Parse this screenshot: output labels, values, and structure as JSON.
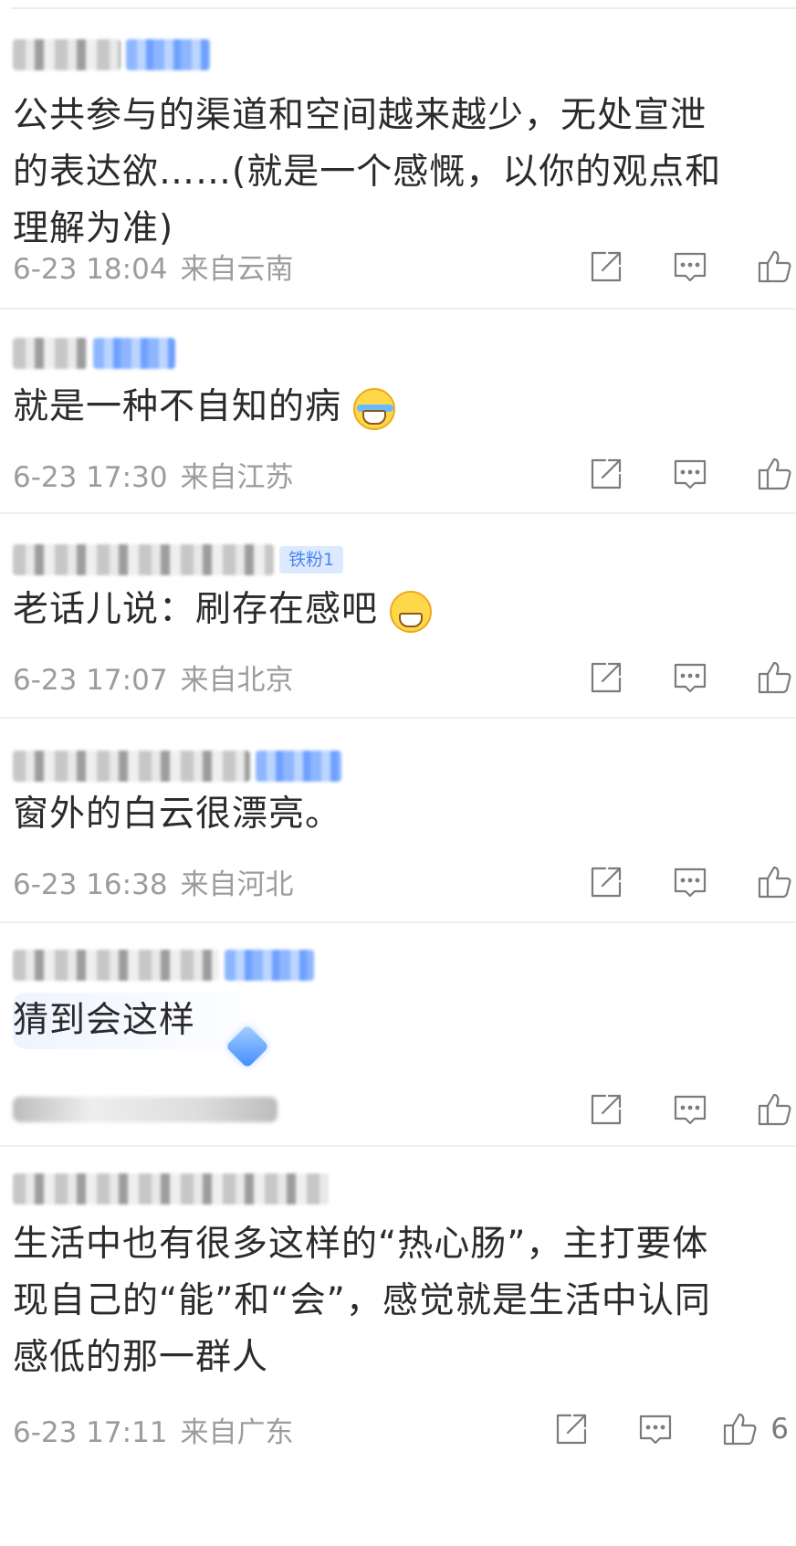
{
  "comments": [
    {
      "text": "公共参与的渠道和空间越来越少，无处宣泄的表达欲……(就是一个感慨，以你的观点和理解为准)",
      "time": "6-23 18:04",
      "location": "来自云南"
    },
    {
      "text": "就是一种不自知的病",
      "emoji": "laughing-crying-emoji",
      "time": "6-23 17:30",
      "location": "来自江苏"
    },
    {
      "text": "老话儿说：刷存在感吧",
      "emoji": "grinning-emoji",
      "badge": "铁粉1",
      "time": "6-23 17:07",
      "location": "来自北京"
    },
    {
      "text": "窗外的白云很漂亮。",
      "time": "6-23 16:38",
      "location": "来自河北"
    },
    {
      "text": "猜到会这样",
      "decoration": "diamond-icon"
    },
    {
      "text": "生活中也有很多这样的“热心肠”，主打要体现自己的“能”和“会”，感觉就是生活中认同感低的那一群人",
      "time": "6-23 17:11",
      "location": "来自广东",
      "likes": "6"
    }
  ],
  "icons": {
    "share": "share-icon",
    "comment": "comment-icon",
    "like": "thumbs-up-icon"
  },
  "colors": {
    "text": "#2b2b2b",
    "meta": "#9c9c9c",
    "icon": "#7b7b7b",
    "badge_bg": "#dce9ff",
    "badge_text": "#4a86f0"
  }
}
